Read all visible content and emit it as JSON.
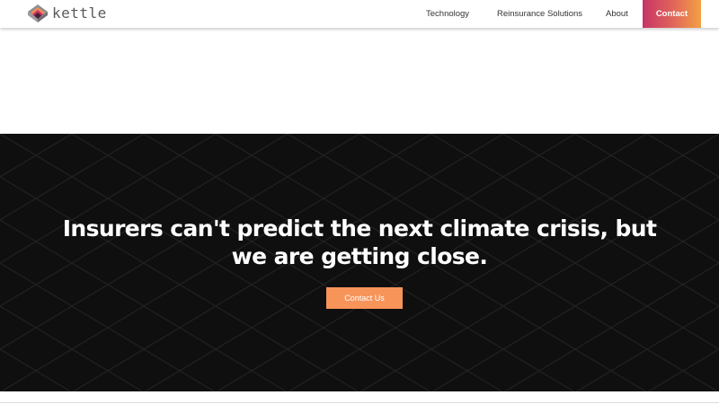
{
  "brand": {
    "name": "kettle",
    "logo_icon": "layered-diamond-logo-icon"
  },
  "nav": {
    "links": [
      "Technology",
      "Reinsurance Solutions",
      "About"
    ],
    "contact_label": "Contact"
  },
  "hero": {
    "title_lines": [
      "Insurers can't predict the next climate crisis, but",
      "we are getting close."
    ],
    "cta_label": "Contact Us"
  },
  "colors": {
    "contact_gradient": [
      "#c73466",
      "#e2685a",
      "#f2a144"
    ],
    "cta": "#f7945a",
    "hero_background": "#0f0f0f"
  }
}
